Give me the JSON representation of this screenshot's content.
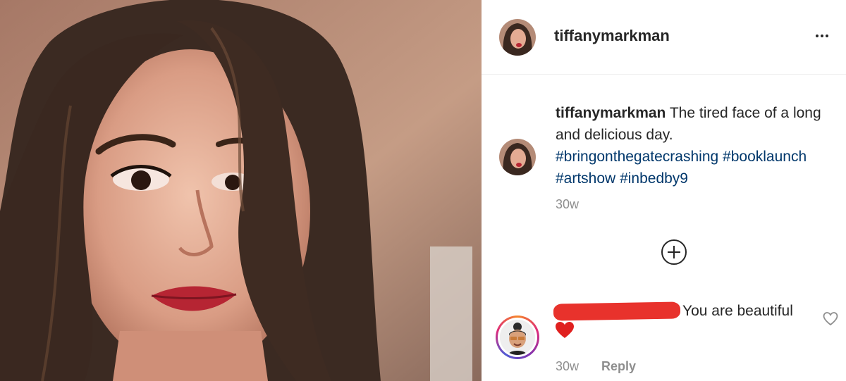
{
  "post": {
    "username": "tiffanymarkman",
    "caption": {
      "username": "tiffanymarkman",
      "text": " The tired face of a long and delicious day.",
      "hashtags": [
        "#bringonthegatecrashing",
        "#booklaunch",
        "#artshow",
        "#inbedby9"
      ],
      "time": "30w"
    },
    "icons": {
      "more": "more-options-icon",
      "load_more": "plus-circle-icon",
      "like": "heart-outline-icon",
      "emoji": "red-heart-emoji"
    }
  },
  "comment": {
    "text": "You are beautiful",
    "time": "30w",
    "reply_label": "Reply"
  },
  "colors": {
    "hashtag": "#00376b",
    "muted": "#8e8e8e",
    "text": "#262626",
    "redaction": "#e8322c"
  }
}
